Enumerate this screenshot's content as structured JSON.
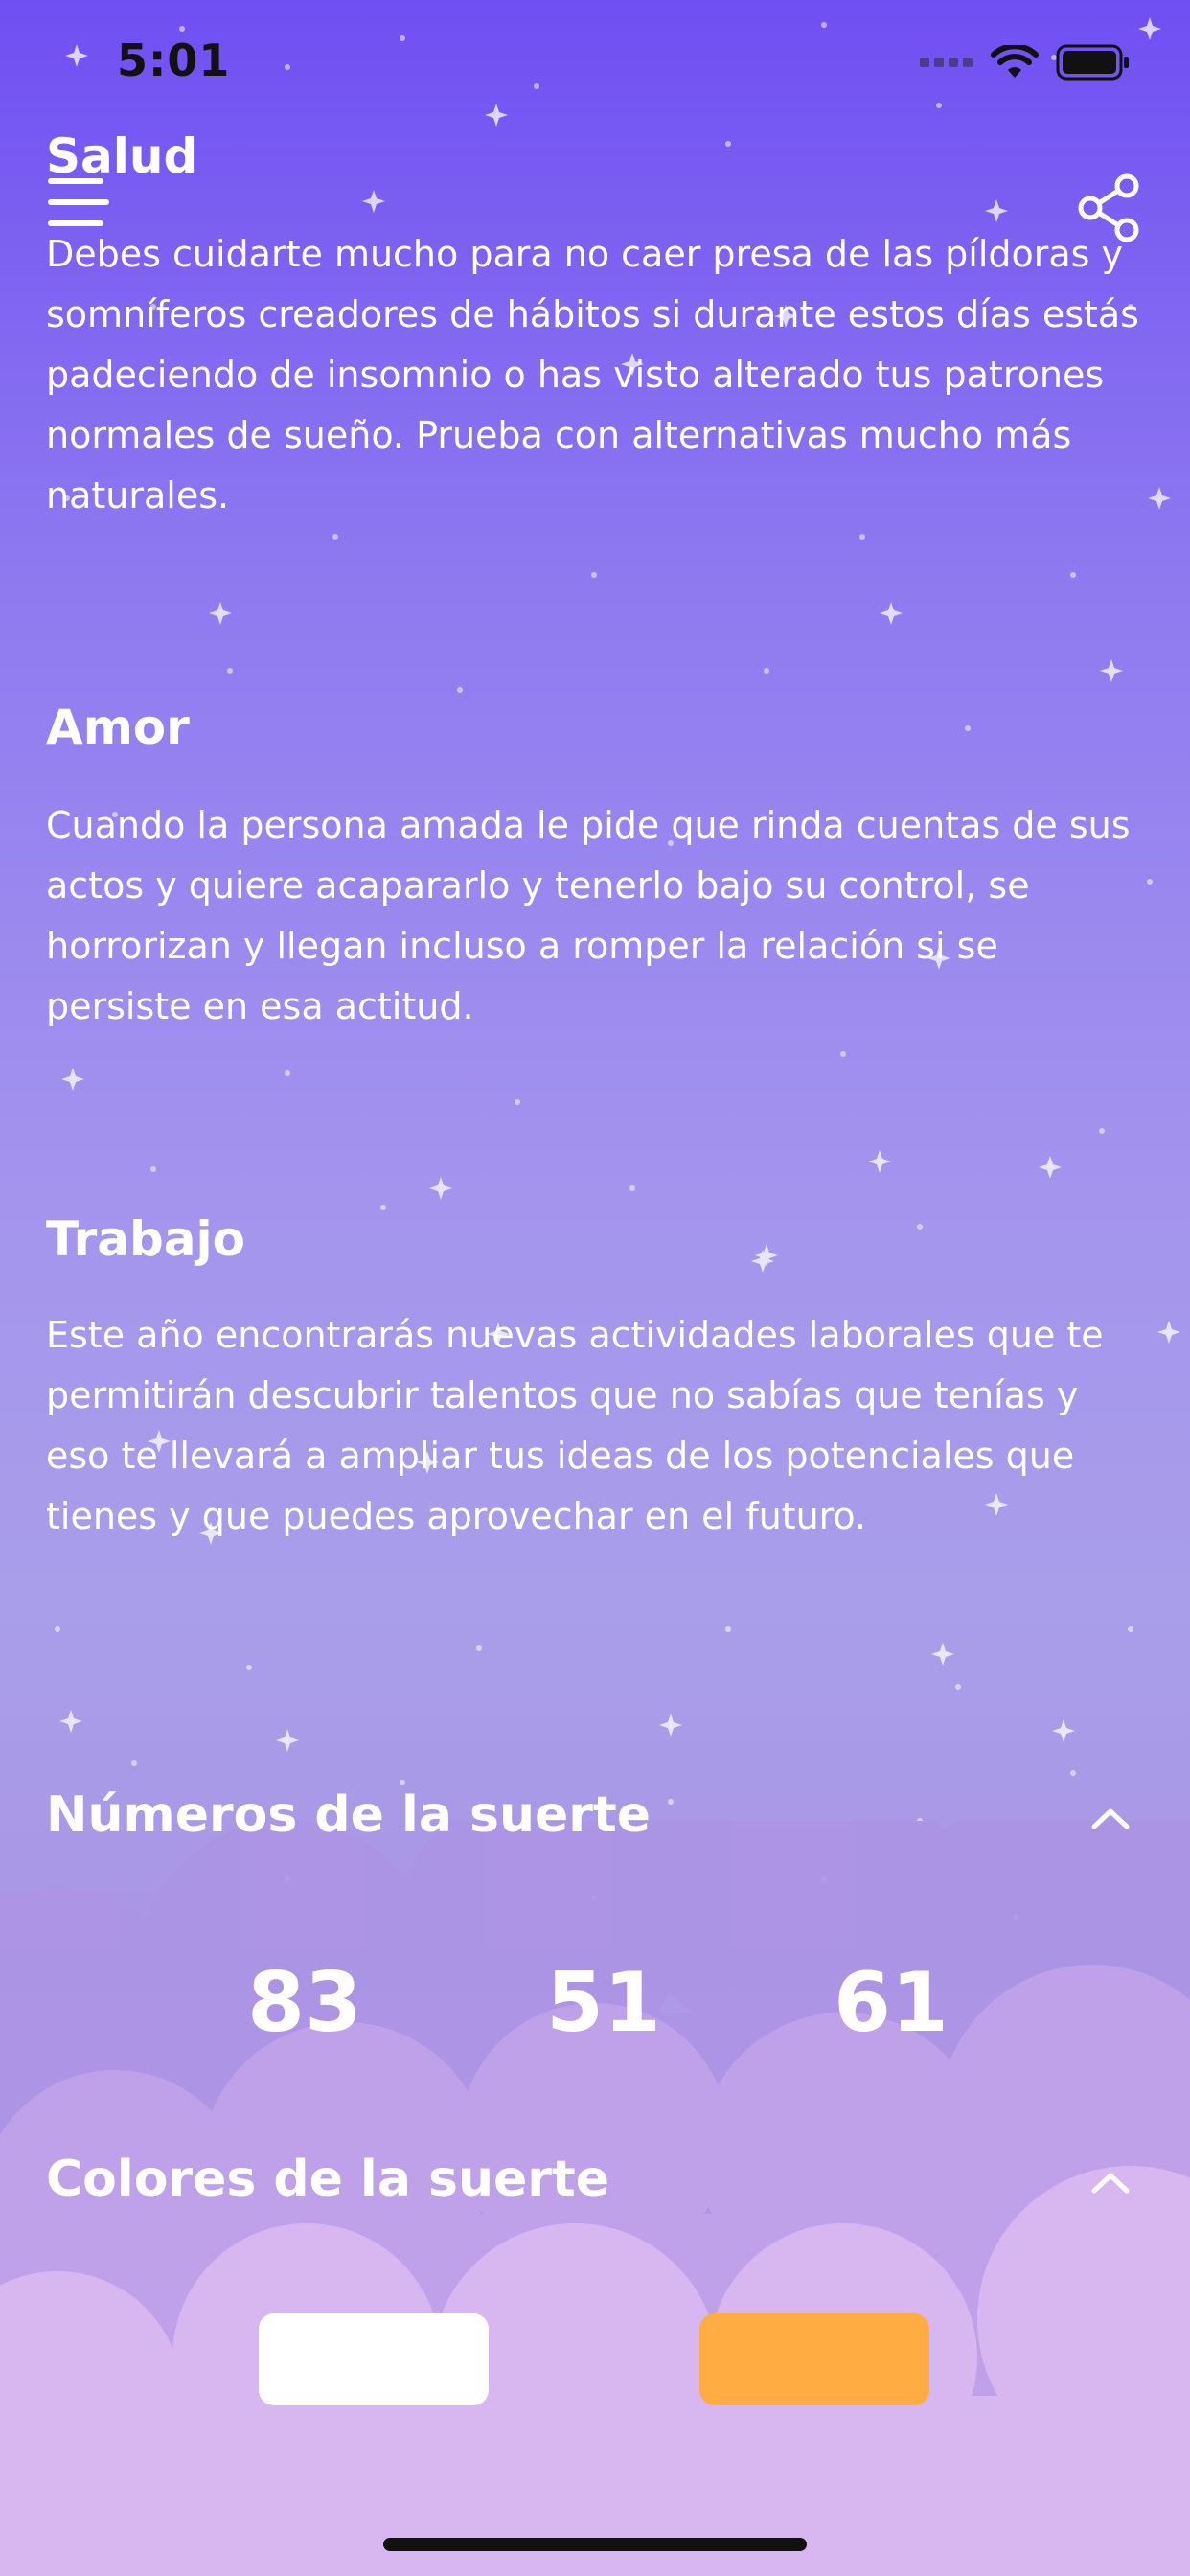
{
  "status_bar": {
    "time": "5:01"
  },
  "sections": [
    {
      "title": "Salud",
      "text": "Debes cuidarte mucho para no caer presa de las píldoras y somníferos creadores de hábitos si durante estos días estás padeciendo de insomnio o has visto alterado tus patrones normales de sueño. Prueba con alternativas mucho más naturales."
    },
    {
      "title": "Amor",
      "text": "Cuando la persona amada le pide que rinda cuentas de sus actos y quiere acapararlo y tenerlo bajo su control, se horrorizan y llegan incluso a romper la relación si se persiste en esa actitud."
    },
    {
      "title": "Trabajo",
      "text": "Este año encontrarás nuevas actividades laborales que te permitirán descubrir talentos que no sabías que tenías y eso te llevará a ampliar tus ideas de los potenciales que tienes y que puedes aprovechar en el futuro."
    }
  ],
  "lucky_numbers": {
    "title": "Números de la suerte",
    "values": [
      "83",
      "51",
      "61"
    ]
  },
  "lucky_colors": {
    "title": "Colores de la suerte",
    "swatches": [
      "#ffffff",
      "#ffad42"
    ]
  },
  "icons": {
    "menu": "hamburger-menu-icon",
    "share": "share-icon",
    "collapse": "chevron-up-icon"
  }
}
